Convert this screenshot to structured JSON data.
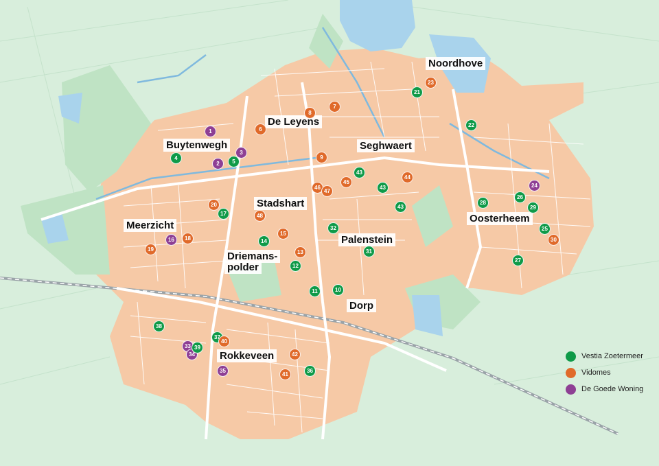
{
  "colors": {
    "background": "#d8eedc",
    "built_area": "#f6c9a6",
    "green_area": "#bfe3c4",
    "water": "#a9d3ec",
    "street": "#ffffff",
    "vestia": "#0f9a48",
    "vidomes": "#e06a2a",
    "goede_woning": "#8e3f94"
  },
  "districts": [
    {
      "name": "Noordhove"
    },
    {
      "name": "De Leyens"
    },
    {
      "name": "Buytenwegh"
    },
    {
      "name": "Seghwaert"
    },
    {
      "name": "Stadshart"
    },
    {
      "name": "Meerzicht"
    },
    {
      "name": "Oosterheem"
    },
    {
      "name": "Palenstein"
    },
    {
      "name": "Driemans-"
    },
    {
      "name": "polder"
    },
    {
      "name": "Dorp"
    },
    {
      "name": "Rokkeveen"
    }
  ],
  "markers": [
    {
      "label": "1",
      "owner": "goede_woning"
    },
    {
      "label": "2",
      "owner": "goede_woning"
    },
    {
      "label": "3",
      "owner": "goede_woning"
    },
    {
      "label": "4",
      "owner": "vestia"
    },
    {
      "label": "5",
      "owner": "vestia"
    },
    {
      "label": "6",
      "owner": "vidomes"
    },
    {
      "label": "7",
      "owner": "vidomes"
    },
    {
      "label": "8",
      "owner": "vidomes"
    },
    {
      "label": "9",
      "owner": "vidomes"
    },
    {
      "label": "10",
      "owner": "vestia"
    },
    {
      "label": "11",
      "owner": "vestia"
    },
    {
      "label": "12",
      "owner": "vestia"
    },
    {
      "label": "13",
      "owner": "vidomes"
    },
    {
      "label": "14",
      "owner": "vestia"
    },
    {
      "label": "15",
      "owner": "vidomes"
    },
    {
      "label": "16",
      "owner": "goede_woning"
    },
    {
      "label": "17",
      "owner": "vestia"
    },
    {
      "label": "18",
      "owner": "vidomes"
    },
    {
      "label": "19",
      "owner": "vidomes"
    },
    {
      "label": "20",
      "owner": "vidomes"
    },
    {
      "label": "21",
      "owner": "vestia"
    },
    {
      "label": "22",
      "owner": "vestia"
    },
    {
      "label": "23",
      "owner": "vidomes"
    },
    {
      "label": "24",
      "owner": "goede_woning"
    },
    {
      "label": "25",
      "owner": "vestia"
    },
    {
      "label": "26",
      "owner": "vestia"
    },
    {
      "label": "27",
      "owner": "vestia"
    },
    {
      "label": "28",
      "owner": "vestia"
    },
    {
      "label": "29",
      "owner": "vestia"
    },
    {
      "label": "30",
      "owner": "vidomes"
    },
    {
      "label": "31",
      "owner": "vestia"
    },
    {
      "label": "32",
      "owner": "vestia"
    },
    {
      "label": "33",
      "owner": "goede_woning"
    },
    {
      "label": "34",
      "owner": "goede_woning"
    },
    {
      "label": "35",
      "owner": "goede_woning"
    },
    {
      "label": "36",
      "owner": "vestia"
    },
    {
      "label": "37",
      "owner": "vestia"
    },
    {
      "label": "38",
      "owner": "vestia"
    },
    {
      "label": "39",
      "owner": "vestia"
    },
    {
      "label": "40",
      "owner": "vidomes"
    },
    {
      "label": "41",
      "owner": "vidomes"
    },
    {
      "label": "42",
      "owner": "vidomes"
    },
    {
      "label": "43",
      "owner": "vestia"
    },
    {
      "label": "43",
      "owner": "vestia"
    },
    {
      "label": "43",
      "owner": "vestia"
    },
    {
      "label": "44",
      "owner": "vidomes"
    },
    {
      "label": "45",
      "owner": "vidomes"
    },
    {
      "label": "46",
      "owner": "vidomes"
    },
    {
      "label": "47",
      "owner": "vidomes"
    },
    {
      "label": "48",
      "owner": "vidomes"
    }
  ],
  "legend": [
    {
      "label": "Vestia Zoetermeer",
      "owner": "vestia"
    },
    {
      "label": "Vidomes",
      "owner": "vidomes"
    },
    {
      "label": "De Goede Woning",
      "owner": "goede_woning"
    }
  ]
}
